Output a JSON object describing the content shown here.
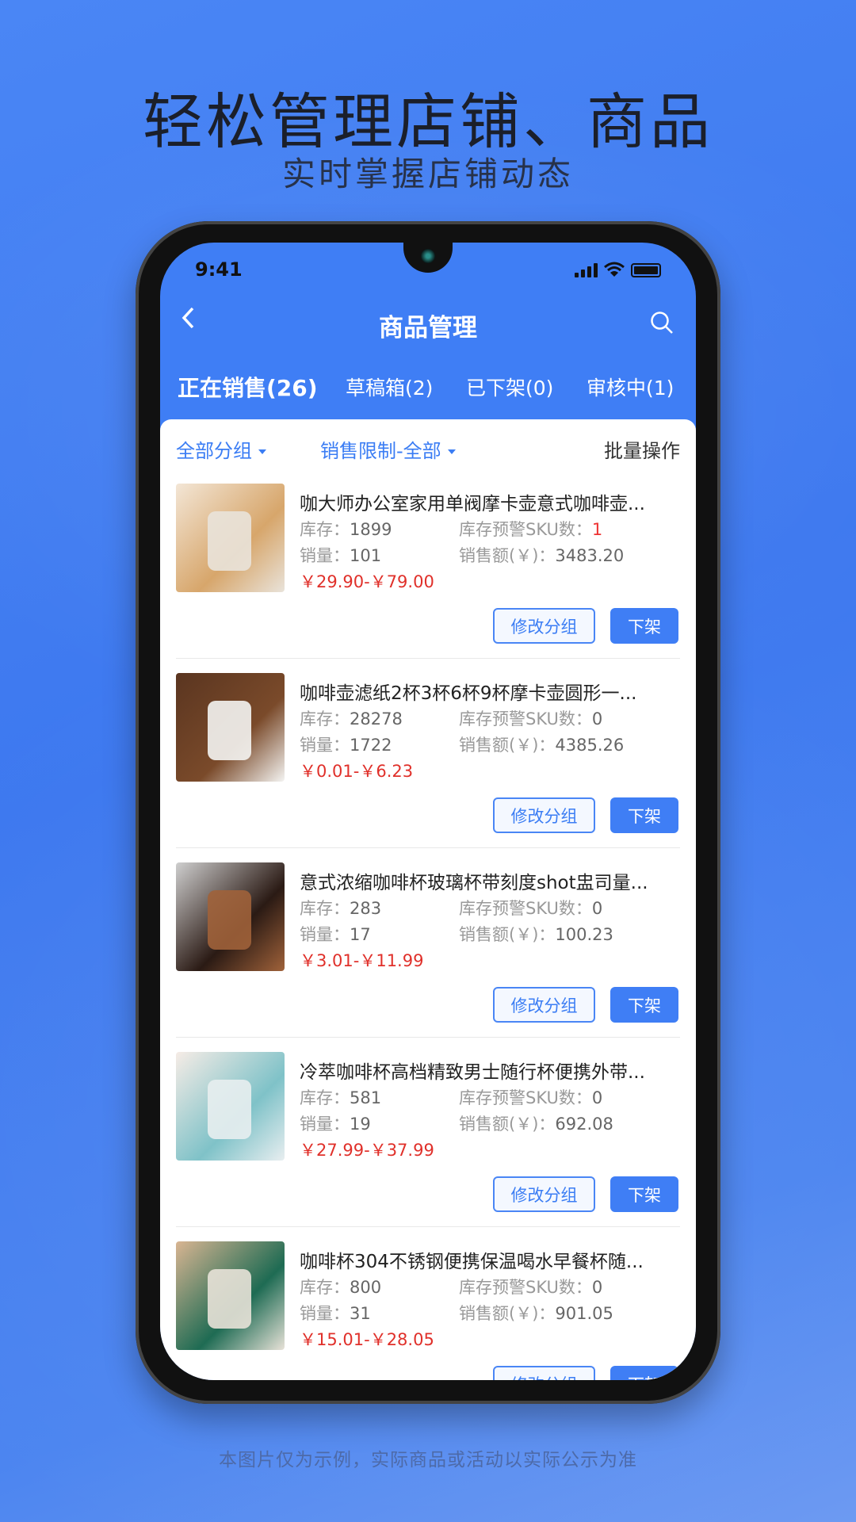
{
  "promo": {
    "headline": "轻松管理店铺、商品",
    "subline": "实时掌握店铺动态",
    "disclaimer": "本图片仅为示例，实际商品或活动以实际公示为准"
  },
  "status_bar": {
    "time": "9:41"
  },
  "nav": {
    "title": "商品管理",
    "back_icon": "chevron-left-icon",
    "search_icon": "search-icon"
  },
  "tabs": [
    {
      "label": "正在销售(26)",
      "active": true
    },
    {
      "label": "草稿箱(2)"
    },
    {
      "label": "已下架(0)"
    },
    {
      "label": "审核中(1)"
    }
  ],
  "filters": {
    "group": "全部分组",
    "limit": "销售限制-全部",
    "batch": "批量操作"
  },
  "labels": {
    "stock": "库存：",
    "warn": "库存预警SKU数：",
    "sales": "销量：",
    "amount": "销售额(￥)：",
    "btn_group": "修改分组",
    "btn_off": "下架"
  },
  "colors": {
    "accent": "#3f7ef5",
    "price": "#e0302a"
  },
  "items": [
    {
      "title": "咖大师办公室家用单阀摩卡壶意式咖啡壶...",
      "stock": "1899",
      "warn": "1",
      "sales": "101",
      "amount": "3483.20",
      "price": "￥29.90-￥79.00",
      "thumb": [
        "#f3e6d6",
        "#d7a66b",
        "#e9e3da"
      ]
    },
    {
      "title": "咖啡壶滤纸2杯3杯6杯9杯摩卡壶圆形一...",
      "stock": "28278",
      "warn": "0",
      "sales": "1722",
      "amount": "4385.26",
      "price": "￥0.01-￥6.23",
      "thumb": [
        "#5a3520",
        "#7a4a2a",
        "#f4f4f2"
      ]
    },
    {
      "title": "意式浓缩咖啡杯玻璃杯带刻度shot盅司量...",
      "stock": "283",
      "warn": "0",
      "sales": "17",
      "amount": "100.23",
      "price": "￥3.01-￥11.99",
      "thumb": [
        "#cfcfcf",
        "#2a1a14",
        "#a0623a"
      ]
    },
    {
      "title": "冷萃咖啡杯高档精致男士随行杯便携外带...",
      "stock": "581",
      "warn": "0",
      "sales": "19",
      "amount": "692.08",
      "price": "￥27.99-￥37.99",
      "thumb": [
        "#f6ece6",
        "#7fc2c8",
        "#e8eef0"
      ]
    },
    {
      "title": "咖啡杯304不锈钢便携保温喝水早餐杯随...",
      "stock": "800",
      "warn": "0",
      "sales": "31",
      "amount": "901.05",
      "price": "￥15.01-￥28.05",
      "thumb": [
        "#d9b592",
        "#1e6b53",
        "#e8e2d8"
      ]
    }
  ]
}
